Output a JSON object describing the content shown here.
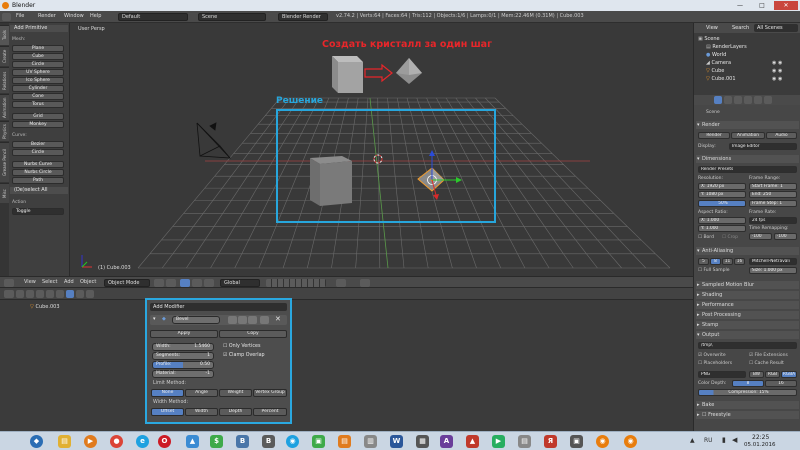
{
  "window": {
    "title": "Blender",
    "controls": [
      "—",
      "□",
      "✕"
    ]
  },
  "info_header": {
    "menus": [
      "File",
      "Render",
      "Window",
      "Help"
    ],
    "layout": "Default",
    "scene": "Scene",
    "engine": "Blender Render",
    "stats": "v2.74.2 | Verts:64 | Faces:64 | Tris:112 | Objects:1/6 | Lamps:0/1 | Mem:22.46M (0.31M) | Cube.003"
  },
  "tool_shelf": {
    "tabs": [
      "Tools",
      "Create",
      "Relations",
      "Animation",
      "Physics",
      "Grease Pencil",
      "Misc"
    ],
    "title": "Add Primitive",
    "mesh_label": "Mesh:",
    "mesh_items": [
      "Plane",
      "Cube",
      "Circle",
      "UV Sphere",
      "Ico Sphere",
      "Cylinder",
      "Cone",
      "Torus"
    ],
    "extra_items": [
      "Grid",
      "Monkey"
    ],
    "curve_label": "Curve:",
    "curve_items": [
      "Bezier",
      "Circle"
    ],
    "nurbs_items": [
      "Nurbs Curve",
      "Nurbs Circle",
      "Path"
    ],
    "operator_title": "(De)select All",
    "action_label": "Action",
    "action_value": "Toggle"
  },
  "viewport": {
    "view_name": "User Persp",
    "object_label": "(1) Cube.003",
    "annotation_title": "Создать кристалл за один шаг",
    "annotation_label": "Решение"
  },
  "view3d_header": {
    "menus": [
      "View",
      "Select",
      "Add",
      "Object"
    ],
    "mode": "Object Mode",
    "orientation": "Global"
  },
  "outliner": {
    "menus": [
      "View",
      "Search",
      "All Scenes"
    ],
    "items": [
      "Scene",
      "RenderLayers",
      "World",
      "Camera",
      "Cube",
      "Cube.001"
    ]
  },
  "properties": {
    "breadcrumb": "Scene",
    "render_title": "Render",
    "render_buttons": [
      "Render",
      "Animation",
      "Audio"
    ],
    "display_label": "Display:",
    "display_value": "Image Editor",
    "dimensions_title": "Dimensions",
    "render_presets": "Render Presets",
    "resolution_label": "Resolution:",
    "res_x": "X:    1920 px",
    "res_y": "Y:    1080 px",
    "res_pct": "50%",
    "frame_range_label": "Frame Range:",
    "frame_start": "Start Frame: 1",
    "frame_end": "End: 250",
    "frame_step": "Frame Step: 1",
    "aspect_label": "Aspect Ratio:",
    "aspect_x": "X:    1.000",
    "aspect_y": "Y:    1.000",
    "frame_rate_label": "Frame Rate:",
    "frame_rate": "24 fps",
    "time_remap_label": "Time Remapping:",
    "remap_old": "·100",
    "remap_new": "·100",
    "border": "Bord",
    "crop": "Crop",
    "aa_title": "Anti-Aliasing",
    "aa_samples": [
      "5",
      "8",
      "11",
      "16"
    ],
    "aa_filter": "Mitchell-Netravali",
    "full_sample": "Full Sample",
    "aa_size": "Size: 1.000 px",
    "closed_panels": [
      "Sampled Motion Blur",
      "Shading",
      "Performance",
      "Post Processing",
      "Stamp"
    ],
    "output_title": "Output",
    "output_path": "/tmp\\",
    "overwrite": "Overwrite",
    "file_ext": "File Extensions",
    "placeholders": "Placeholders",
    "cache_result": "Cache Result",
    "format": "PNG",
    "color_modes": [
      "BW",
      "RGB",
      "RGBA"
    ],
    "color_depth_label": "Color Depth:",
    "color_depths": [
      "8",
      "16"
    ],
    "compression": "Compression: 15%",
    "bake": "Bake",
    "freestyle": "Freestyle"
  },
  "bottom_editor": {
    "tab_items": [
      "View",
      "Search",
      "All Scenes"
    ],
    "object_row": "Cube.003"
  },
  "modifier_panel": {
    "title": "Add Modifier",
    "modifier_name": "Bevel",
    "apply": "Apply",
    "copy": "Copy",
    "width_label": "Width:",
    "width_value": "1.5460",
    "segments_label": "Segments:",
    "segments_value": "1",
    "profile_label": "Profile:",
    "profile_value": "0.50",
    "material_label": "Material:",
    "material_value": "-1",
    "only_vertices": "Only Vertices",
    "clamp_overlap": "Clamp Overlap",
    "limit_label": "Limit Method:",
    "limit_options": [
      "None",
      "Angle",
      "Weight",
      "Vertex Group"
    ],
    "width_method_label": "Width Method:",
    "width_options": [
      "Offset",
      "Width",
      "Depth",
      "Percent"
    ]
  },
  "taskbar": {
    "time": "22:25",
    "date": "05.01.2016",
    "lang": "RU"
  },
  "colors": {
    "annotation_red": "#e8262a",
    "annotation_blue": "#27a6dc",
    "selected_orange": "#f39c2a",
    "accent_blue": "#5680c2"
  }
}
